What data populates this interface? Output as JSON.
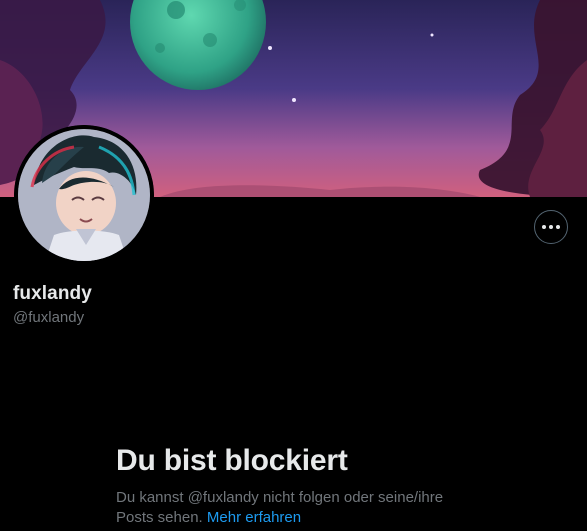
{
  "profile": {
    "display_name": "fuxlandy",
    "handle": "@fuxlandy"
  },
  "header": {
    "more_button_icon": "more-horizontal-icon"
  },
  "blocked": {
    "title": "Du bist blockiert",
    "description_line1": "Du kannst @fuxlandy nicht folgen oder seine/ihre",
    "description_line2": "Posts sehen.",
    "learn_more": "Mehr erfahren"
  },
  "colors": {
    "background": "#000000",
    "primary_text": "#e7e9ea",
    "secondary_text": "#71767b",
    "link": "#1d9bf0",
    "button_border": "#536471"
  }
}
